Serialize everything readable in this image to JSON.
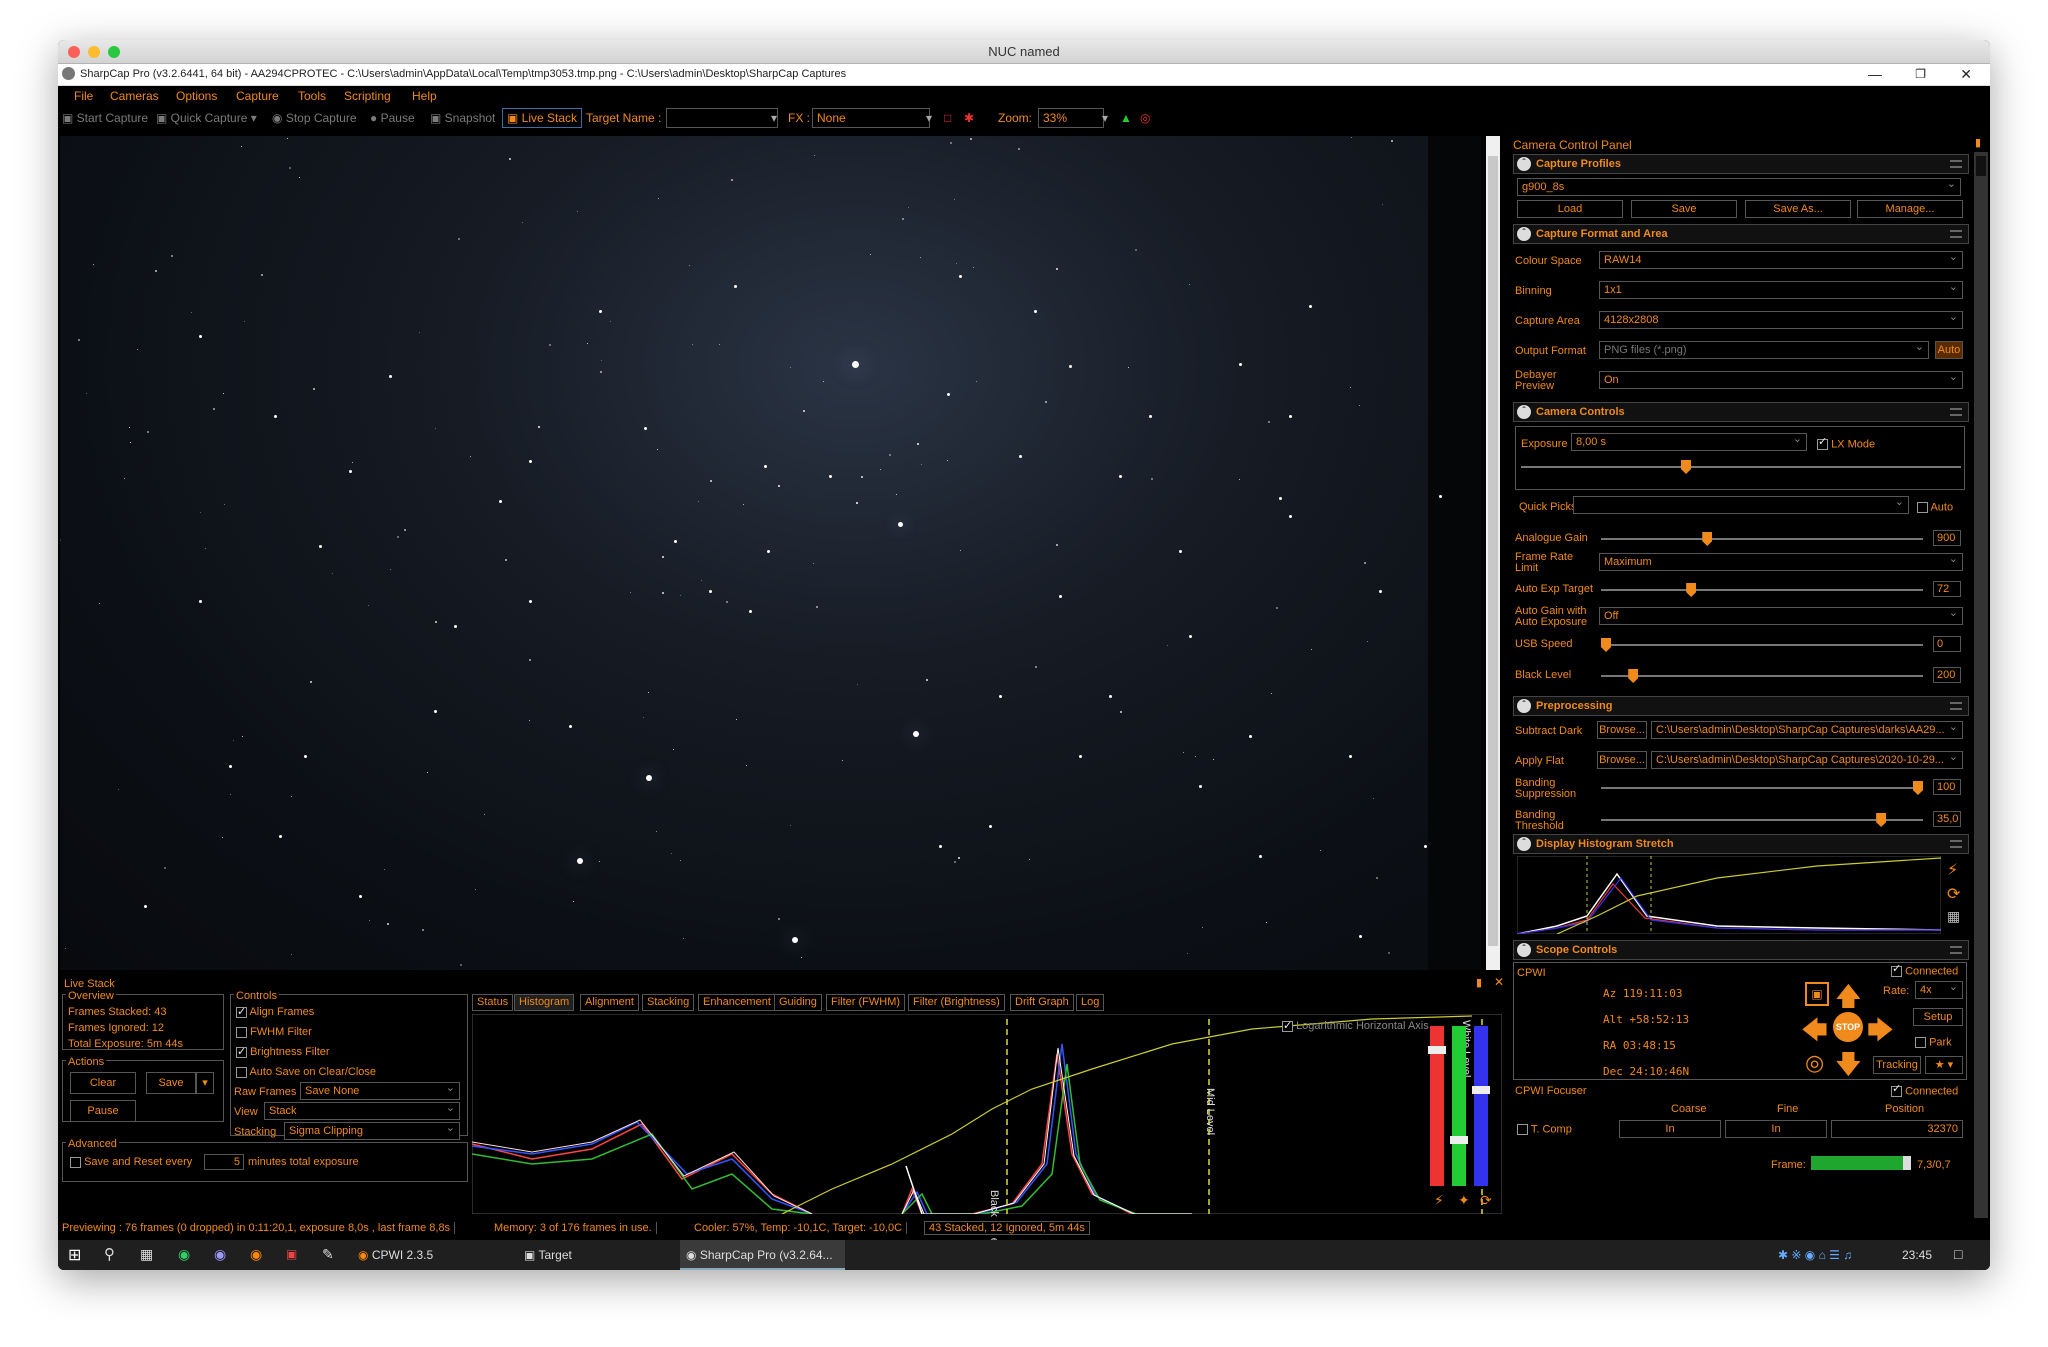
{
  "mac": {
    "title": "NUC named"
  },
  "app": {
    "title": "SharpCap Pro (v3.2.6441, 64 bit) - AA294CPROTEC - C:\\Users\\admin\\AppData\\Local\\Temp\\tmp3053.tmp.png - C:\\Users\\admin\\Desktop\\SharpCap Captures"
  },
  "menu": [
    "File",
    "Cameras",
    "Options",
    "Capture",
    "Tools",
    "Scripting",
    "Help"
  ],
  "toolbar": {
    "start_capture": "Start Capture",
    "quick_capture": "Quick Capture",
    "stop_capture": "Stop Capture",
    "pause": "Pause",
    "snapshot": "Snapshot",
    "live_stack": "Live Stack",
    "target_name_label": "Target Name :",
    "target_name_value": "",
    "fx_label": "FX :",
    "fx_value": "None",
    "zoom_label": "Zoom:",
    "zoom_value": "33%"
  },
  "ccp": {
    "title": "Camera Control Panel",
    "capture_profiles": {
      "title": "Capture Profiles",
      "profile": "g900_8s",
      "load": "Load",
      "save": "Save",
      "save_as": "Save As...",
      "manage": "Manage..."
    },
    "format": {
      "title": "Capture Format and Area",
      "colour_space_label": "Colour Space",
      "colour_space": "RAW14",
      "binning_label": "Binning",
      "binning": "1x1",
      "capture_area_label": "Capture Area",
      "capture_area": "4128x2808",
      "output_format_label": "Output Format",
      "output_format": "PNG files (*.png)",
      "auto": "Auto",
      "debayer_label_1": "Debayer",
      "debayer_label_2": "Preview",
      "debayer": "On"
    },
    "camera": {
      "title": "Camera Controls",
      "exposure_label": "Exposure",
      "exposure": "8,00 s",
      "lx_mode": "LX Mode",
      "quick_picks_label": "Quick Picks",
      "quick_picks": "",
      "auto": "Auto",
      "analogue_gain_label": "Analogue Gain",
      "analogue_gain": "900",
      "analogue_gain_frac": 0.33,
      "frame_rate_label_1": "Frame Rate",
      "frame_rate_label_2": "Limit",
      "frame_rate": "Maximum",
      "auto_exp_label": "Auto Exp Target",
      "auto_exp": "72",
      "auto_exp_frac": 0.28,
      "auto_gain_label_1": "Auto Gain with",
      "auto_gain_label_2": "Auto Exposure",
      "auto_gain": "Off",
      "usb_speed_label": "USB Speed",
      "usb_speed": "0",
      "usb_speed_frac": 0.0,
      "black_level_label": "Black Level",
      "black_level": "200",
      "black_level_frac": 0.1
    },
    "pre": {
      "title": "Preprocessing",
      "subtract_dark_label": "Subtract Dark",
      "browse": "Browse...",
      "subtract_dark": "C:\\Users\\admin\\Desktop\\SharpCap Captures\\darks\\AA29...",
      "apply_flat_label": "Apply Flat",
      "apply_flat": "C:\\Users\\admin\\Desktop\\SharpCap Captures\\2020-10-29...",
      "banding_supp_label_1": "Banding",
      "banding_supp_label_2": "Suppression",
      "banding_supp": "100",
      "banding_supp_frac": 0.99,
      "banding_thr_label_1": "Banding",
      "banding_thr_label_2": "Threshold",
      "banding_thr": "35,0",
      "banding_thr_frac": 0.87
    },
    "histo": {
      "title": "Display Histogram Stretch"
    },
    "scope": {
      "title": "Scope Controls",
      "cpwi": "CPWI",
      "connected": "Connected",
      "az": "Az  119:11:03",
      "alt": "Alt +58:52:13",
      "ra": "RA  03:48:15",
      "dec": "Dec 24:10:46N",
      "rate_label": "Rate:",
      "rate": "4x",
      "setup": "Setup",
      "park": "Park",
      "tracking": "Tracking",
      "stop": "STOP",
      "focuser": "CPWI Focuser",
      "coarse": "Coarse",
      "fine": "Fine",
      "position": "Position",
      "tcomp": "T. Comp",
      "in": "In",
      "pos_value": "32370"
    },
    "frame_label": "Frame:",
    "frame_value": "7,3/0,7",
    "frame_frac": 0.92
  },
  "live_stack": {
    "title": "Live Stack",
    "overview": "Overview",
    "frames_stacked": "Frames Stacked: 43",
    "frames_ignored": "Frames Ignored:  12",
    "total_exposure": "Total Exposure:  5m 44s",
    "actions": "Actions",
    "clear": "Clear",
    "save": "Save",
    "pause": "Pause",
    "advanced": "Advanced",
    "save_reset": "Save and Reset every",
    "reset_minutes": "5",
    "minutes_label": "minutes total exposure",
    "controls": "Controls",
    "align_frames": "Align Frames",
    "fwhm_filter": "FWHM Filter",
    "brightness_filter": "Brightness Filter",
    "auto_save": "Auto Save on Clear/Close",
    "raw_frames_label": "Raw Frames",
    "raw_frames": "Save None",
    "view_label": "View",
    "view": "Stack",
    "stacking_label": "Stacking",
    "stacking": "Sigma Clipping",
    "tabs": [
      "Status",
      "Histogram",
      "Alignment",
      "Stacking",
      "Enhancement",
      "Guiding",
      "Filter (FWHM)",
      "Filter (Brightness)",
      "Drift Graph",
      "Log"
    ],
    "log_axis": "Logarithmic Horizontal Axis",
    "black_level": "Black Level",
    "mid_level": "Mid Level",
    "white_level": "White Level"
  },
  "status": {
    "previewing": "Previewing : 76 frames (0 dropped) in 0:11:20,1, exposure 8,0s , last frame 8,8s",
    "memory": "Memory: 3 of 176 frames in use.",
    "cooler": "Cooler: 57%, Temp: -10,1C, Target: -10,0C",
    "stacked": "43 Stacked, 12 Ignored, 5m 44s"
  },
  "taskbar": {
    "cpwi": "CPWI 2.3.5",
    "target": "Target",
    "sharpcap": "SharpCap Pro (v3.2.64...",
    "time": "23:45"
  },
  "colors": {
    "accent": "#f08a1c",
    "bg": "#000000",
    "sky": "#0c1016"
  }
}
